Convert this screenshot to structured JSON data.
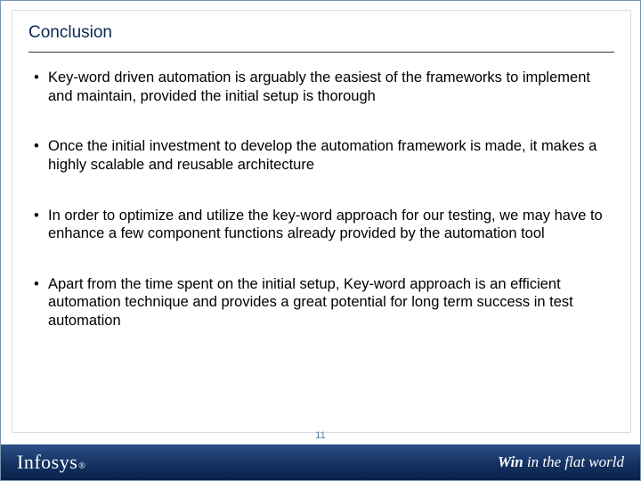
{
  "title": "Conclusion",
  "bullets": [
    "Key-word driven automation is arguably the easiest of the frameworks to implement and maintain, provided the initial setup is thorough",
    "Once the initial investment to develop the automation framework is made, it makes a highly scalable and reusable architecture",
    "In order to optimize and utilize the key-word approach for our testing, we may have to enhance a few component functions already provided by the automation tool",
    "Apart from the time spent on the initial setup, Key-word approach is an efficient automation technique and provides a great potential for long term success in test automation"
  ],
  "footer": {
    "logo": "Infosys",
    "reg": "®",
    "tagline_bold": "Win",
    "tagline_rest": " in the flat world"
  },
  "page_number": "11"
}
